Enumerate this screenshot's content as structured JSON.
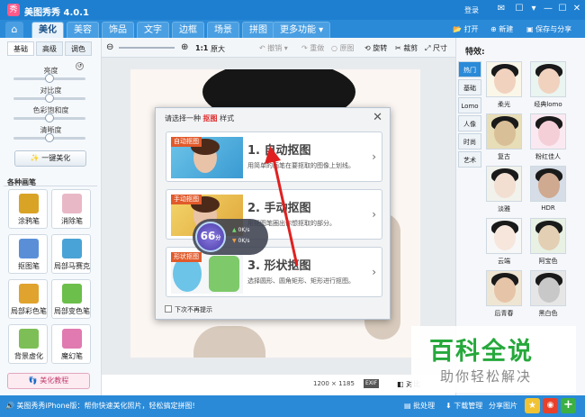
{
  "app": {
    "title": "美图秀秀 4.0.1",
    "login": "登录",
    "logo_glyph": "秀"
  },
  "window_controls": [
    "✉",
    "☐",
    "▾",
    "—",
    "☐",
    "✕"
  ],
  "tabs": [
    "美化",
    "美容",
    "饰品",
    "文字",
    "边框",
    "场景",
    "拼图",
    "更多功能 ▾"
  ],
  "top_buttons": {
    "open": "打开",
    "new": "新建",
    "save": "保存与分享"
  },
  "toolbar": {
    "ratio": "1:1",
    "original": "原大",
    "undo": "撤销",
    "redo": "重做",
    "orig_img": "原图",
    "rotate": "旋转",
    "crop": "裁剪",
    "size": "尺寸"
  },
  "left": {
    "subtabs": [
      "基础",
      "高级",
      "调色"
    ],
    "sliders": [
      {
        "label": "亮度",
        "value": 0.5
      },
      {
        "label": "对比度",
        "value": 0.5
      },
      {
        "label": "色彩饱和度",
        "value": 0.5
      },
      {
        "label": "清晰度",
        "value": 0.5
      }
    ],
    "one_click": "一键美化",
    "brushes_title": "各种画笔",
    "tools": [
      {
        "label": "涂鸦笔",
        "icon": "brush-icon",
        "color": "#d9a326"
      },
      {
        "label": "消除笔",
        "icon": "eraser-icon",
        "color": "#e9b8c6"
      },
      {
        "label": "抠图笔",
        "icon": "cutout-icon",
        "color": "#5a8fd8"
      },
      {
        "label": "局部马赛克",
        "icon": "mosaic-icon",
        "color": "#4aa3d6"
      },
      {
        "label": "局部彩色笔",
        "icon": "color-pen-icon",
        "color": "#e0a32e"
      },
      {
        "label": "局部变色笔",
        "icon": "recolor-icon",
        "color": "#6cbf4a"
      },
      {
        "label": "背景虚化",
        "icon": "blur-icon",
        "color": "#7dbf56"
      },
      {
        "label": "魔幻笔",
        "icon": "magic-pen-icon",
        "color": "#e07ab0"
      }
    ],
    "tutorial": "美化教程"
  },
  "dialog": {
    "title_prefix": "请选择一种",
    "title_key": "抠图",
    "title_suffix": "样式",
    "options": [
      {
        "tag": "自动抠图",
        "title": "1. 自动抠图",
        "desc": "用简单的画笔在要抠取的图像上划线。"
      },
      {
        "tag": "手动抠图",
        "title": "2. 手动抠图",
        "desc": "用抠图笔圈出你想抠取的部分。"
      },
      {
        "tag": "形状抠图",
        "title": "3. 形状抠图",
        "desc": "选择圆形、圆角矩形、矩形进行抠图。"
      }
    ],
    "no_prompt": "下次不再提示"
  },
  "speed": {
    "value": "66",
    "unit": "分",
    "up": "0K/s",
    "down": "0K/s"
  },
  "canvas_info": {
    "size": "1200 × 1185",
    "exif": "EXIF",
    "compare": "对比"
  },
  "right": {
    "title": "特效:",
    "tabs": [
      "热门",
      "基础",
      "Lomo",
      "人像",
      "时尚",
      "艺术"
    ],
    "effects": [
      "柔光",
      "经典lomo",
      "复古",
      "粉红佳人",
      "淡雅",
      "HDR",
      "云端",
      "阿宝色",
      "后青春",
      "黑白色"
    ]
  },
  "status": {
    "text": "美图秀秀iPhone版：帮你快速美化照片，轻松搞定拼图!",
    "batch": "批处理",
    "download": "下载管理",
    "share": "分享图片"
  },
  "watermark": {
    "title": "百科全说",
    "subtitle": "助你轻松解决"
  },
  "colors": {
    "accent": "#2a8ad8",
    "title_red": "#e03030",
    "arrow_red": "#e02020"
  }
}
